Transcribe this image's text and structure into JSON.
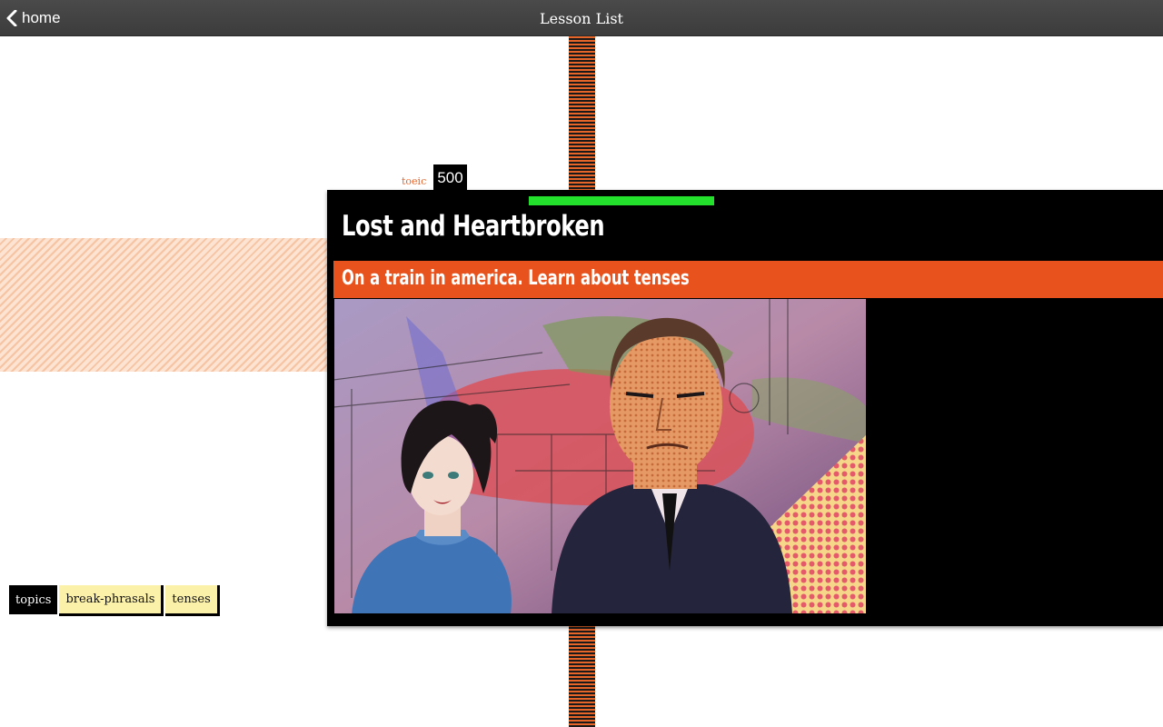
{
  "header": {
    "back_label": "home",
    "title": "Lesson List"
  },
  "lesson": {
    "level_label": "toeic",
    "level_value": "500",
    "progress": 0.47,
    "title": "Lost and Heartbroken",
    "subtitle": "On a train in america. Learn about tenses"
  },
  "topics": {
    "header": "topics",
    "tags": [
      "break-phrasals",
      "tenses"
    ]
  },
  "colors": {
    "accent_orange": "#e8521c",
    "progress_green": "#22e02b",
    "tag_yellow": "#fcf1a8"
  }
}
